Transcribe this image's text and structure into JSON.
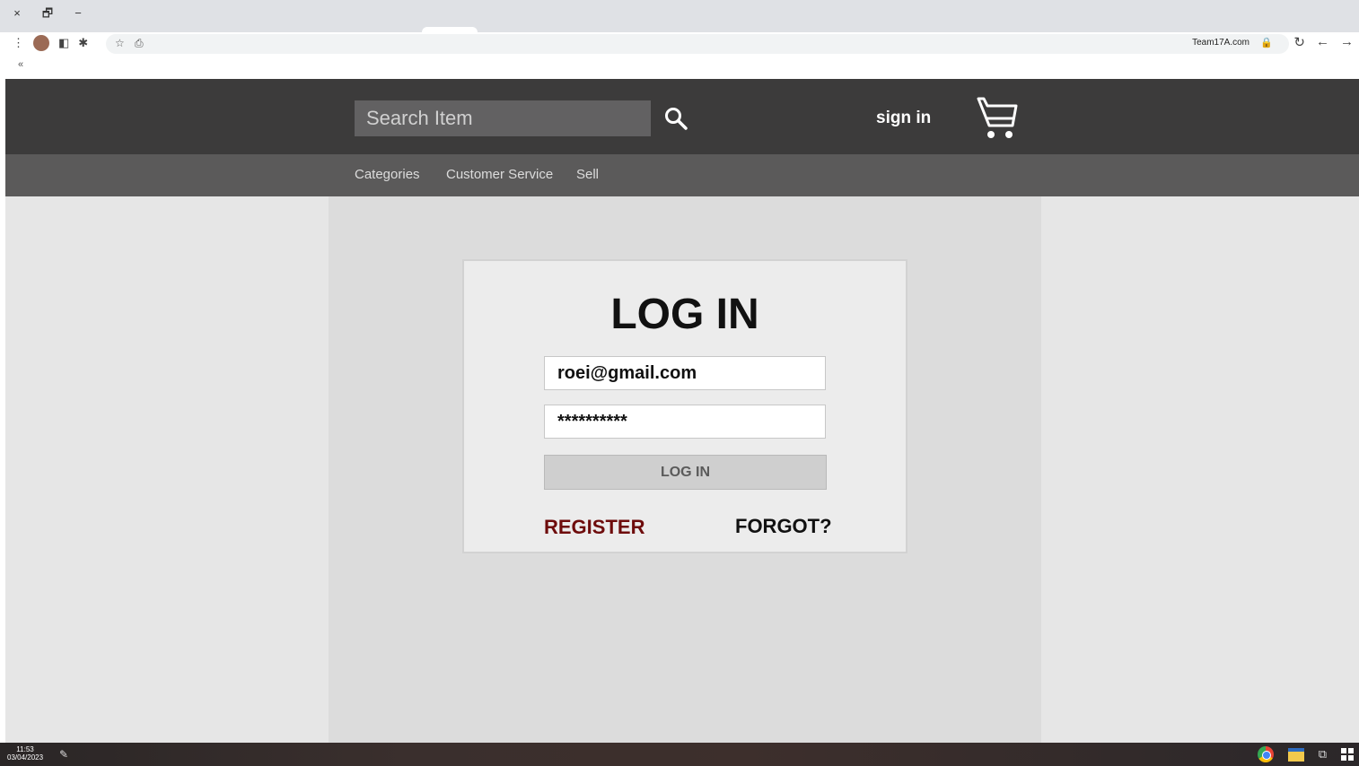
{
  "browser": {
    "url": "Team17A.com",
    "window_controls": [
      "×",
      "🗗",
      "−"
    ],
    "collapse_label": "«"
  },
  "site": {
    "search": {
      "placeholder": "Search Item"
    },
    "sign_in_label": "sign in",
    "nav": [
      "Categories",
      "Customer Service",
      "Sell"
    ]
  },
  "login": {
    "title": "LOG IN",
    "email_value": "roei@gmail.com",
    "password_value": "**********",
    "button_label": "LOG IN",
    "register_label": "REGISTER",
    "forgot_label": "FORGOT?"
  },
  "taskbar": {
    "time": "11:53",
    "date": "03/04/2023"
  },
  "colors": {
    "header_bg": "#3c3b3b",
    "subnav_bg": "#5b5a5a",
    "register": "#6e0c0c"
  }
}
